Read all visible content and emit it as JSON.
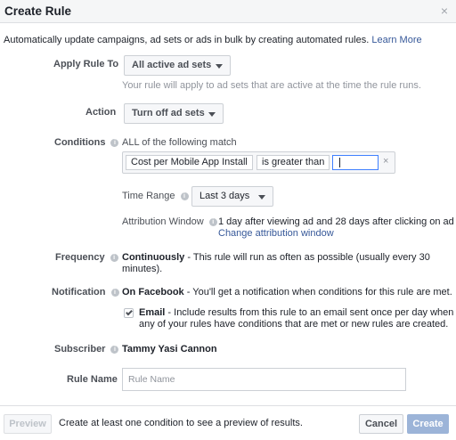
{
  "dialog": {
    "title": "Create Rule",
    "close_glyph": "×",
    "description": "Automatically update campaigns, ad sets or ads in bulk by creating automated rules.",
    "learn_more": "Learn More"
  },
  "apply_rule": {
    "label": "Apply Rule To",
    "value": "All active ad sets",
    "helper": "Your rule will apply to ad sets that are active at the time the rule runs."
  },
  "action": {
    "label": "Action",
    "value": "Turn off ad sets"
  },
  "conditions": {
    "label": "Conditions",
    "match_text": "ALL of the following match",
    "metric": "Cost per Mobile App Install",
    "operator": "is greater than",
    "value": "",
    "remove_glyph": "×",
    "time_range_label": "Time Range",
    "time_range_value": "Last 3 days",
    "attribution_label": "Attribution Window",
    "attribution_value": "1 day after viewing ad and 28 days after clicking on ad",
    "attribution_link": "Change attribution window"
  },
  "frequency": {
    "label": "Frequency",
    "value_bold": "Continuously",
    "value_line1": " - This rule will run as often as possible (usually every 30",
    "value_line2": "minutes)."
  },
  "notification": {
    "label": "Notification",
    "value_bold": "On Facebook",
    "value_text": " - You'll get a notification when conditions for this rule are met.",
    "email_checked": true,
    "email_bold": "Email",
    "email_line1": " - Include results from this rule to an email sent once per day when",
    "email_line2": "any of your rules have conditions that are met or new rules are created."
  },
  "subscriber": {
    "label": "Subscriber",
    "value": "Tammy Yasi Cannon"
  },
  "rule_name": {
    "label": "Rule Name",
    "placeholder": "Rule Name",
    "value": ""
  },
  "footer": {
    "preview_label": "Preview",
    "note": "Create at least one condition to see a preview of results.",
    "cancel_label": "Cancel",
    "create_label": "Create"
  }
}
